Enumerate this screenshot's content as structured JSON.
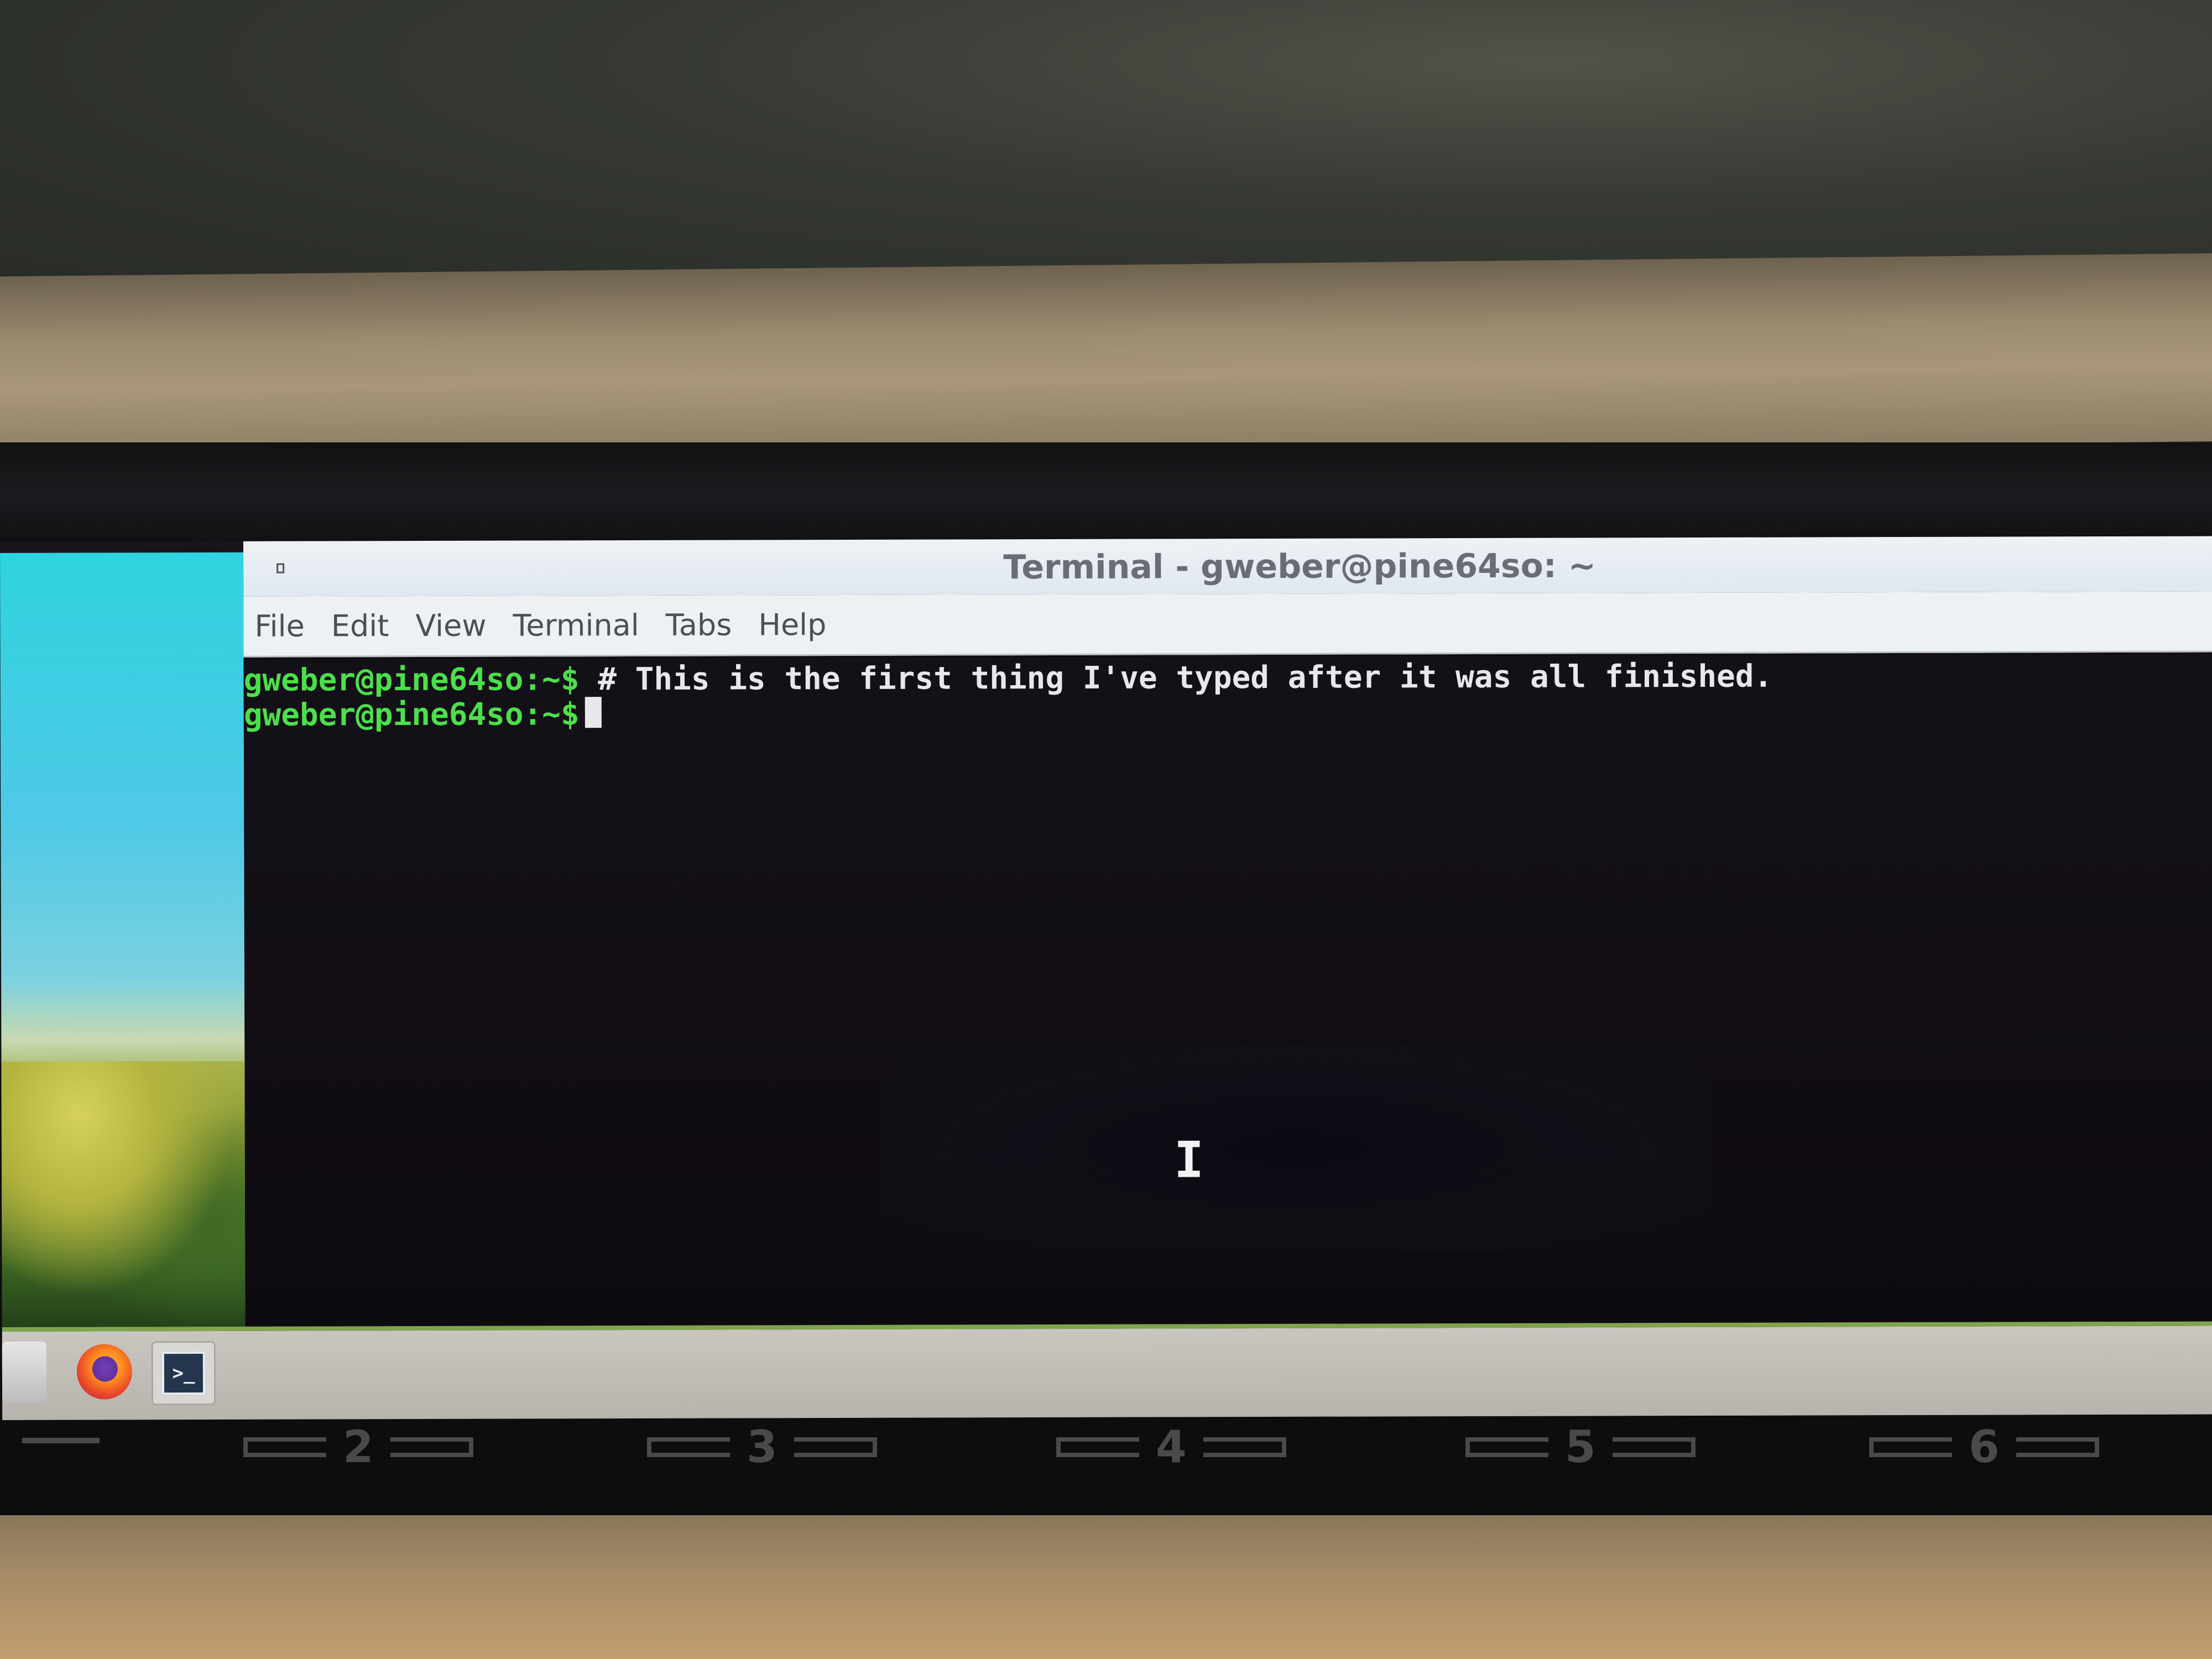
{
  "window": {
    "title": "Terminal - gweber@pine64so: ~"
  },
  "menubar": {
    "items": [
      "File",
      "Edit",
      "View",
      "Terminal",
      "Tabs",
      "Help"
    ]
  },
  "terminal": {
    "lines": [
      {
        "prompt": "gweber@pine64so:~$",
        "command": " # This is the first thing I've typed after it was all finished."
      },
      {
        "prompt": "gweber@pine64so:~$",
        "command": " "
      }
    ],
    "pointer": "I"
  },
  "taskbar": {
    "icons": [
      "files-icon",
      "firefox-icon",
      "terminal-icon"
    ],
    "terminal_glyph": ">_"
  },
  "bezel": {
    "keys": [
      "2",
      "3",
      "4",
      "5",
      "6"
    ]
  },
  "colors": {
    "prompt": "#4be04a",
    "text": "#e8e8ea",
    "terminal_bg": "#120e14",
    "titlebar": "#e4eaf0"
  }
}
